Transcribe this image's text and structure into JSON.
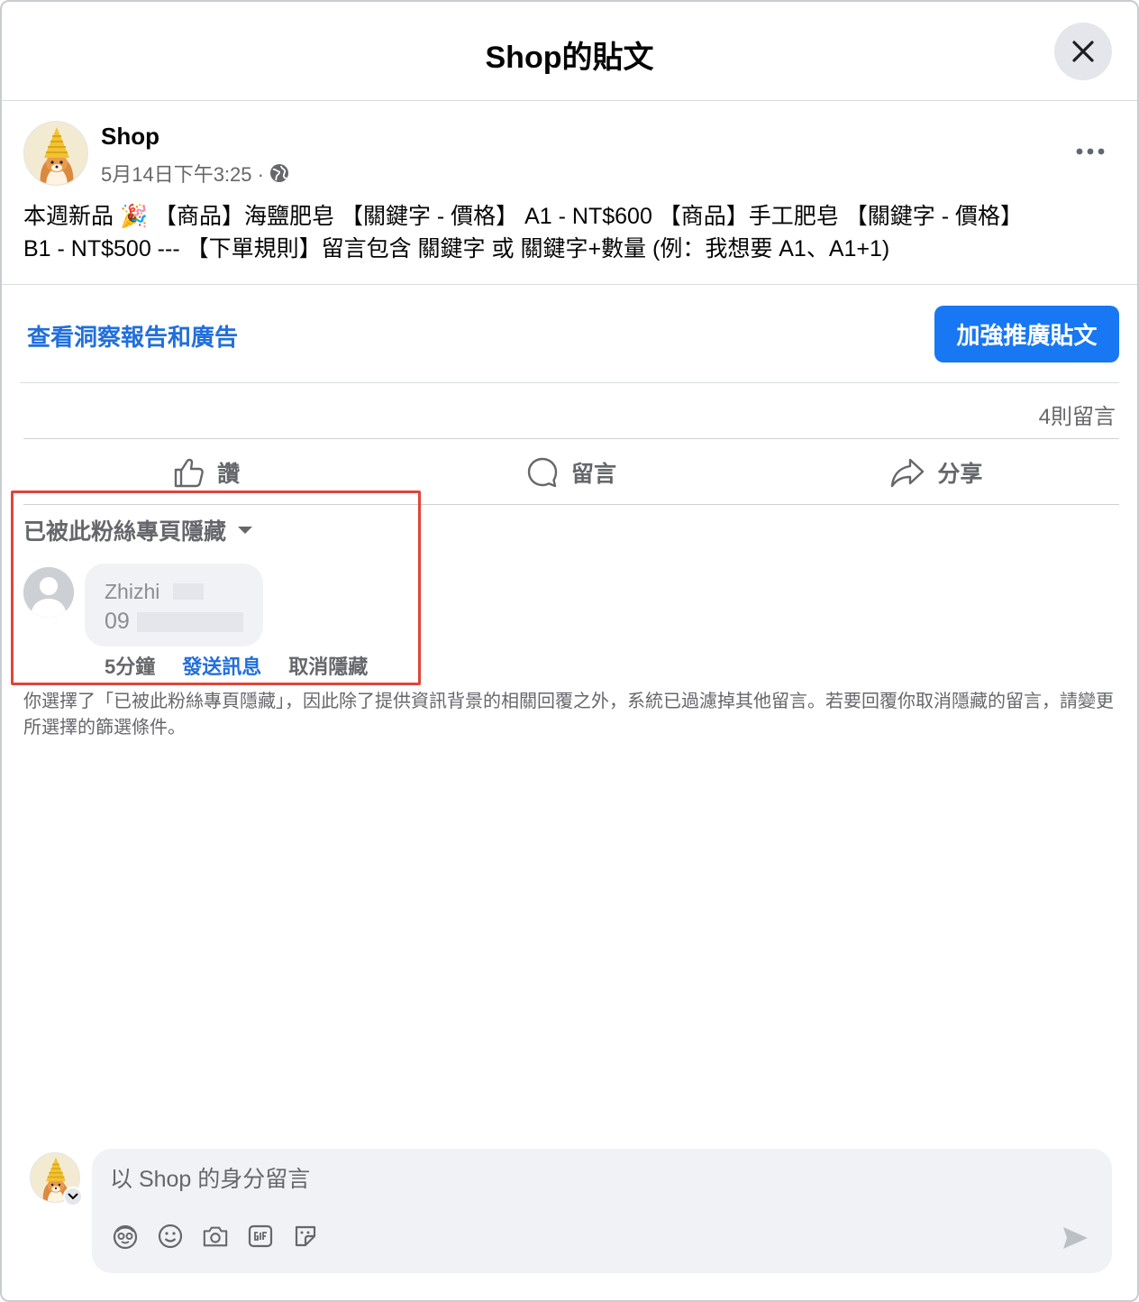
{
  "dialog": {
    "title": "Shop的貼文",
    "close_icon": "close-icon"
  },
  "post": {
    "author": "Shop",
    "timestamp": "5月14日下午3:25 ·",
    "privacy_icon": "globe-icon",
    "body_line1": "本週新品 🎉 【商品】海鹽肥皂 【關鍵字 - 價格】 A1 - NT$600 【商品】手工肥皂 【關鍵字 - 價格】",
    "body_line2": "B1 - NT$500 --- 【下單規則】留言包含 關鍵字 或 關鍵字+數量 (例：我想要 A1、A1+1)"
  },
  "insights": {
    "link_label": "查看洞察報告和廣告",
    "boost_label": "加強推廣貼文"
  },
  "stats": {
    "comment_count": "4則留言"
  },
  "actions": {
    "like": "讚",
    "comment": "留言",
    "share": "分享"
  },
  "filter": {
    "label": "已被此粉絲專頁隱藏"
  },
  "comment": {
    "name": "Zhizhi",
    "text": "09",
    "time": "5分鐘",
    "send_message": "發送訊息",
    "unhide": "取消隱藏"
  },
  "notice": {
    "text": "你選擇了「已被此粉絲專頁隱藏」，因此除了提供資訊背景的相關回覆之外，系統已過濾掉其他留言。若要回覆你取消隱藏的留言，請變更所選擇的篩選條件。"
  },
  "composer": {
    "placeholder": "以 Shop 的身分留言",
    "tools": [
      "avatar-sticker-icon",
      "emoji-icon",
      "camera-icon",
      "gif-icon",
      "sticker-icon"
    ],
    "send_icon": "send-icon"
  },
  "colors": {
    "accent": "#1877f2",
    "link": "#216fdb",
    "highlight_border": "#e0453a",
    "secondary_text": "#65676b"
  }
}
